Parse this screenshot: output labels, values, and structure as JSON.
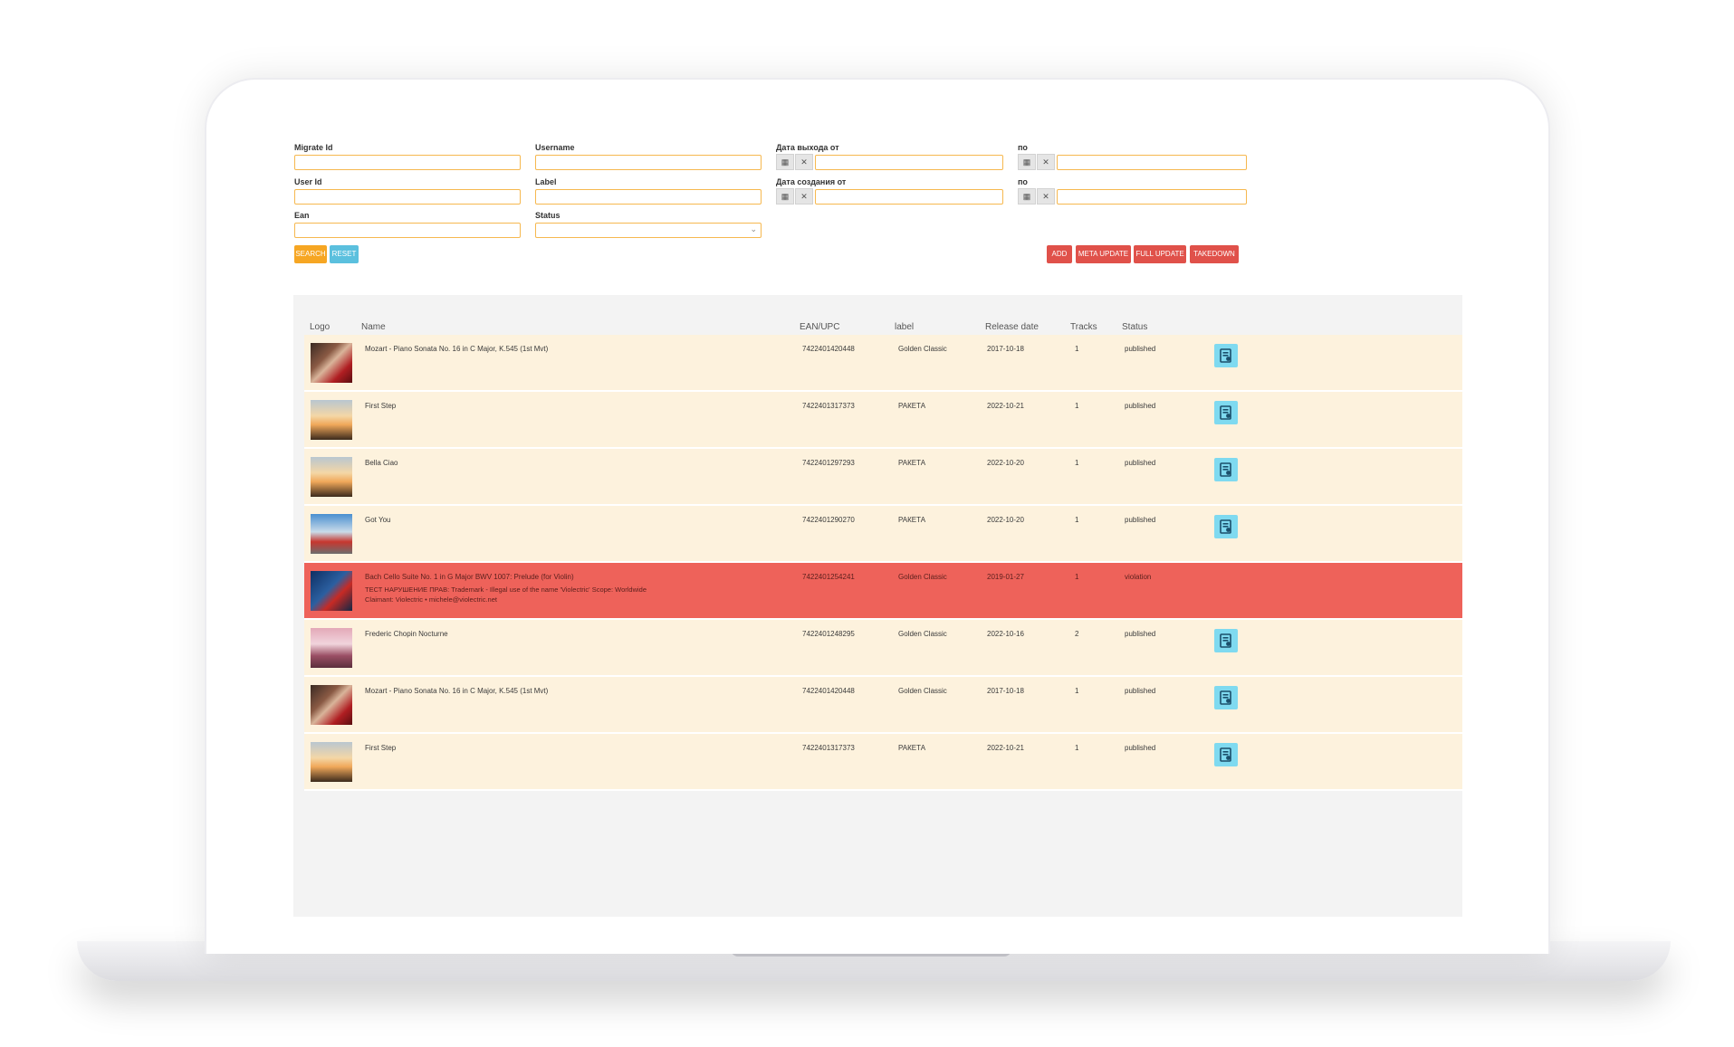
{
  "filters": {
    "migrate_id_label": "Migrate Id",
    "username_label": "Username",
    "release_from_label": "Дата выхода от",
    "release_to_label": "по",
    "user_id_label": "User Id",
    "label_label": "Label",
    "created_from_label": "Дата создания от",
    "created_to_label": "по",
    "ean_label": "Ean",
    "status_label": "Status",
    "calendar_glyph": "▦",
    "clear_glyph": "✕",
    "dropdown_glyph": "⌄"
  },
  "buttons": {
    "search": "Search",
    "reset": "Reset",
    "add": "ADD",
    "meta_update": "META UPDATE",
    "full_update": "FULL UPDATE",
    "takedown": "TAKEDOWN"
  },
  "colors": {
    "accent_orange": "#f6a623",
    "accent_blue": "#5bc0de",
    "danger_red": "#e0514a",
    "row_background": "#fdf2dd",
    "violation_background": "#ee625a",
    "action_button": "#7fdaf0"
  },
  "table": {
    "headers": {
      "logo": "Logo",
      "name": "Name",
      "ean": "EAN/UPC",
      "label": "label",
      "release_date": "Release date",
      "tracks": "Tracks",
      "status": "Status"
    },
    "rows": [
      {
        "thumb": "portrait",
        "name": "Mozart - Piano Sonata No. 16 in C Major, K.545 (1st Mvt)",
        "ean": "7422401420448",
        "label": "Golden Classic",
        "release_date": "2017-10-18",
        "tracks": "1",
        "status": "published",
        "violation": false,
        "action_icon": "edit-icon"
      },
      {
        "thumb": "sunset-runner",
        "name": "First Step",
        "ean": "7422401317373",
        "label": "РАКЕТА",
        "release_date": "2022-10-21",
        "tracks": "1",
        "status": "published",
        "violation": false,
        "action_icon": "edit-icon"
      },
      {
        "thumb": "sunset-runner",
        "name": "Bella Ciao",
        "ean": "7422401297293",
        "label": "РАКЕТА",
        "release_date": "2022-10-20",
        "tracks": "1",
        "status": "published",
        "violation": false,
        "action_icon": "edit-icon"
      },
      {
        "thumb": "city-tram",
        "name": "Got You",
        "ean": "7422401290270",
        "label": "РАКЕТА",
        "release_date": "2022-10-20",
        "tracks": "1",
        "status": "published",
        "violation": false,
        "action_icon": "edit-icon"
      },
      {
        "thumb": "blue-rose",
        "name": "Bach Cello Suite No. 1 in G Major BWV 1007: Prelude (for Violin)",
        "ean": "7422401254241",
        "label": "Golden Classic",
        "release_date": "2019-01-27",
        "tracks": "1",
        "status": "violation",
        "violation": true,
        "note_line1": "ТЕСТ НАРУШЕНИЕ ПРАВ: Trademark - Illegal use of the name 'Violectric' Scope: Worldwide",
        "note_line2": "Claimant: Violectric • michele@violectric.net"
      },
      {
        "thumb": "pink-scene",
        "name": "Frederic Chopin Nocturne",
        "ean": "7422401248295",
        "label": "Golden Classic",
        "release_date": "2022-10-16",
        "tracks": "2",
        "status": "published",
        "violation": false,
        "action_icon": "edit-icon"
      },
      {
        "thumb": "portrait",
        "name": "Mozart - Piano Sonata No. 16 in C Major, K.545 (1st Mvt)",
        "ean": "7422401420448",
        "label": "Golden Classic",
        "release_date": "2017-10-18",
        "tracks": "1",
        "status": "published",
        "violation": false,
        "action_icon": "edit-icon"
      },
      {
        "thumb": "sunset-runner",
        "name": "First Step",
        "ean": "7422401317373",
        "label": "РАКЕТА",
        "release_date": "2022-10-21",
        "tracks": "1",
        "status": "published",
        "violation": false,
        "action_icon": "edit-icon"
      }
    ]
  }
}
